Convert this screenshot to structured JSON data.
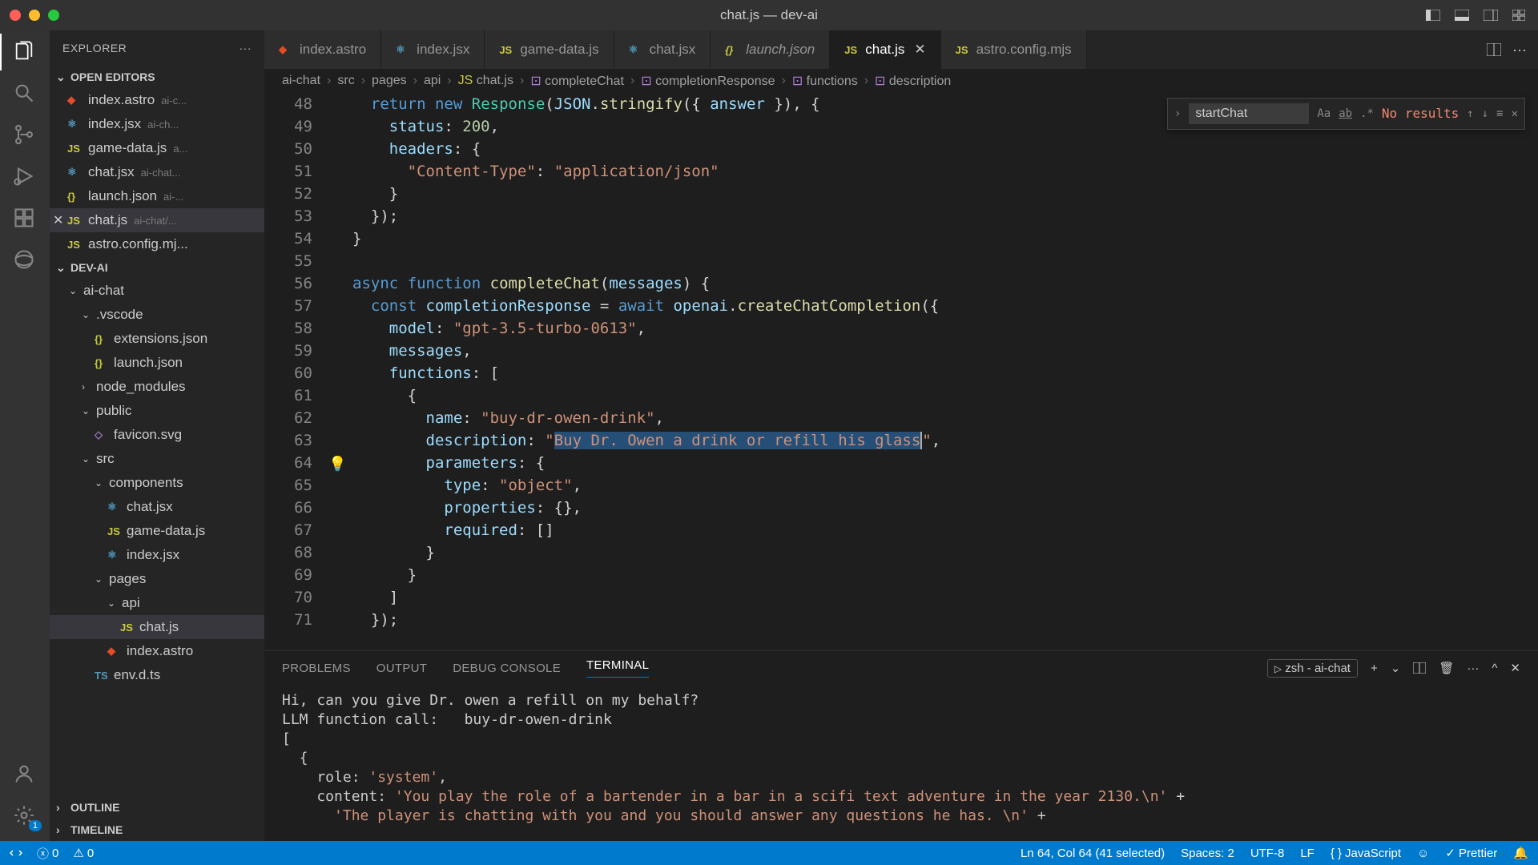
{
  "window": {
    "title": "chat.js — dev-ai"
  },
  "explorer": {
    "title": "EXPLORER",
    "openEditorsLabel": "OPEN EDITORS",
    "openEditors": [
      {
        "name": "index.astro",
        "meta": "ai-c..."
      },
      {
        "name": "index.jsx",
        "meta": "ai-ch..."
      },
      {
        "name": "game-data.js",
        "meta": "a..."
      },
      {
        "name": "chat.jsx",
        "meta": "ai-chat..."
      },
      {
        "name": "launch.json",
        "meta": "ai-..."
      },
      {
        "name": "chat.js",
        "meta": "ai-chat/..."
      },
      {
        "name": "astro.config.mj...",
        "meta": ""
      }
    ],
    "projectLabel": "DEV-AI",
    "tree": [
      {
        "name": "ai-chat",
        "kind": "folder",
        "indent": 1,
        "open": true
      },
      {
        "name": ".vscode",
        "kind": "folder",
        "indent": 2,
        "open": true
      },
      {
        "name": "extensions.json",
        "kind": "file",
        "icon": "json",
        "indent": 3
      },
      {
        "name": "launch.json",
        "kind": "file",
        "icon": "json",
        "indent": 3
      },
      {
        "name": "node_modules",
        "kind": "folder",
        "indent": 2,
        "open": false
      },
      {
        "name": "public",
        "kind": "folder",
        "indent": 2,
        "open": true
      },
      {
        "name": "favicon.svg",
        "kind": "file",
        "icon": "svg",
        "indent": 3
      },
      {
        "name": "src",
        "kind": "folder",
        "indent": 2,
        "open": true
      },
      {
        "name": "components",
        "kind": "folder",
        "indent": 3,
        "open": true
      },
      {
        "name": "chat.jsx",
        "kind": "file",
        "icon": "jsx",
        "indent": 4
      },
      {
        "name": "game-data.js",
        "kind": "file",
        "icon": "js",
        "indent": 4
      },
      {
        "name": "index.jsx",
        "kind": "file",
        "icon": "jsx",
        "indent": 4
      },
      {
        "name": "pages",
        "kind": "folder",
        "indent": 3,
        "open": true
      },
      {
        "name": "api",
        "kind": "folder",
        "indent": 4,
        "open": true
      },
      {
        "name": "chat.js",
        "kind": "file",
        "icon": "js",
        "indent": 5,
        "active": true
      },
      {
        "name": "index.astro",
        "kind": "file",
        "icon": "astro",
        "indent": 4
      },
      {
        "name": "env.d.ts",
        "kind": "file",
        "icon": "ts",
        "indent": 3
      }
    ],
    "outlineLabel": "OUTLINE",
    "timelineLabel": "TIMELINE"
  },
  "tabs": [
    {
      "label": "index.astro",
      "icon": "astro"
    },
    {
      "label": "index.jsx",
      "icon": "jsx"
    },
    {
      "label": "game-data.js",
      "icon": "js"
    },
    {
      "label": "chat.jsx",
      "icon": "jsx"
    },
    {
      "label": "launch.json",
      "icon": "json",
      "italic": true
    },
    {
      "label": "chat.js",
      "icon": "js",
      "active": true
    },
    {
      "label": "astro.config.mjs",
      "icon": "js"
    }
  ],
  "breadcrumbs": [
    "ai-chat",
    "src",
    "pages",
    "api",
    "chat.js",
    "completeChat",
    "completionResponse",
    "functions",
    "description"
  ],
  "find": {
    "value": "startChat",
    "result": "No results"
  },
  "code": {
    "startLine": 48,
    "bulbLine": 64,
    "lines_html": [
      "  <span class='tk-key'>return</span> <span class='tk-key'>new</span> <span class='tk-type'>Response</span><span class='tk-punc'>(</span><span class='tk-prop'>JSON</span><span class='tk-punc'>.</span><span class='tk-fn'>stringify</span><span class='tk-punc'>({ </span><span class='tk-prop'>answer</span><span class='tk-punc'> }), {</span>",
      "    <span class='tk-prop'>status</span><span class='tk-punc'>: </span><span class='tk-num'>200</span><span class='tk-punc'>,</span>",
      "    <span class='tk-prop'>headers</span><span class='tk-punc'>: {</span>",
      "      <span class='tk-str'>\"Content-Type\"</span><span class='tk-punc'>: </span><span class='tk-str'>\"application/json\"</span>",
      "    <span class='tk-punc'>}</span>",
      "  <span class='tk-punc'>});</span>",
      "<span class='tk-punc'>}</span>",
      "",
      "<span class='tk-key'>async</span> <span class='tk-key'>function</span> <span class='tk-fn'>completeChat</span><span class='tk-punc'>(</span><span class='tk-prop'>messages</span><span class='tk-punc'>) {</span>",
      "  <span class='tk-key'>const</span> <span class='tk-prop'>completionResponse</span> <span class='tk-punc'>=</span> <span class='tk-key'>await</span> <span class='tk-prop'>openai</span><span class='tk-punc'>.</span><span class='tk-fn'>createChatCompletion</span><span class='tk-punc'>({</span>",
      "    <span class='tk-prop'>model</span><span class='tk-punc'>: </span><span class='tk-str'>\"gpt-3.5-turbo-0613\"</span><span class='tk-punc'>,</span>",
      "    <span class='tk-prop'>messages</span><span class='tk-punc'>,</span>",
      "    <span class='tk-prop'>functions</span><span class='tk-punc'>: [</span>",
      "      <span class='tk-punc'>{</span>",
      "        <span class='tk-prop'>name</span><span class='tk-punc'>: </span><span class='tk-str'>\"buy-dr-owen-drink\"</span><span class='tk-punc'>,</span>",
      "        <span class='tk-prop'>description</span><span class='tk-punc'>: </span><span class='tk-str'>\"<span class='sel'>Buy Dr. Owen a drink or refill his glass</span></span><span class='cursor-mark'></span><span class='tk-str'>\"</span><span class='tk-punc'>,</span>",
      "        <span class='tk-prop'>parameters</span><span class='tk-punc'>: {</span>",
      "          <span class='tk-prop'>type</span><span class='tk-punc'>: </span><span class='tk-str'>\"object\"</span><span class='tk-punc'>,</span>",
      "          <span class='tk-prop'>properties</span><span class='tk-punc'>: {},</span>",
      "          <span class='tk-prop'>required</span><span class='tk-punc'>: []</span>",
      "        <span class='tk-punc'>}</span>",
      "      <span class='tk-punc'>}</span>",
      "    <span class='tk-punc'>]</span>",
      "  <span class='tk-punc'>});</span>"
    ]
  },
  "panel": {
    "tabs": [
      "PROBLEMS",
      "OUTPUT",
      "DEBUG CONSOLE",
      "TERMINAL"
    ],
    "shell": "zsh - ai-chat",
    "terminal_lines": [
      {
        "text": "Hi, can you give Dr. owen a refill on my behalf?",
        "cls": ""
      },
      {
        "text": "LLM function call:   buy-dr-owen-drink",
        "cls": ""
      },
      {
        "text": "[",
        "cls": ""
      },
      {
        "text": "  {",
        "cls": ""
      },
      {
        "text": "    role: 'system',",
        "cls": "tk-plain",
        "markup": "    role: <span class='term-str'>'system'</span>,"
      },
      {
        "text": "",
        "markup": "    content: <span class='term-str'>'You play the role of a bartender in a bar in a scifi text adventure in the year 2130.\\n'</span> +"
      },
      {
        "text": "",
        "markup": "      <span class='term-str'>'The player is chatting with you and you should answer any questions he has. \\n'</span> +"
      }
    ]
  },
  "statusbar": {
    "errors": "0",
    "warnings": "0",
    "lncol": "Ln 64, Col 64 (41 selected)",
    "spaces": "Spaces: 2",
    "encoding": "UTF-8",
    "eol": "LF",
    "lang": "JavaScript",
    "prettier": "Prettier"
  },
  "activityBadge": "1"
}
